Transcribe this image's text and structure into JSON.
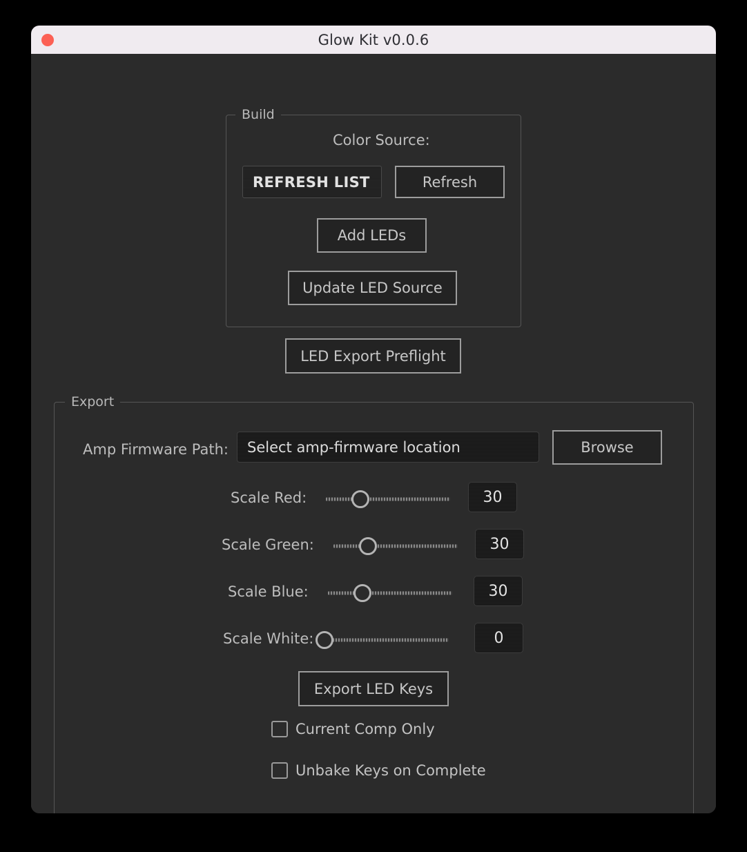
{
  "window": {
    "title": "Glow Kit v0.0.6",
    "close_button": "close",
    "background_color": "#2b2b2b",
    "titlebar_color": "#f0ebf0",
    "accent_close_color": "#fc6054"
  },
  "build": {
    "legend": "Build",
    "color_source_label": "Color Source:",
    "color_source_dropdown": {
      "value": "REFRESH LIST",
      "options": [
        "REFRESH LIST"
      ]
    },
    "refresh_button": "Refresh",
    "add_leds_button": "Add LEDs",
    "update_led_source_button": "Update LED Source"
  },
  "preflight": {
    "led_export_preflight_button": "LED Export Preflight"
  },
  "export": {
    "legend": "Export",
    "amp_firmware_path_label": "Amp Firmware Path:",
    "amp_firmware_path_value": "Select amp-firmware location",
    "amp_firmware_path_placeholder": "Select amp-firmware location",
    "browse_button": "Browse",
    "sliders": [
      {
        "label": "Scale Red:",
        "value": "30",
        "percent": 28
      },
      {
        "label": "Scale Green:",
        "value": "30",
        "percent": 28
      },
      {
        "label": "Scale Blue:",
        "value": "30",
        "percent": 28
      },
      {
        "label": "Scale White:",
        "value": "0",
        "percent": 0
      }
    ],
    "export_led_keys_button": "Export LED Keys",
    "checkboxes": [
      {
        "label": "Current Comp Only",
        "checked": false
      },
      {
        "label": "Unbake Keys on Complete",
        "checked": false
      }
    ]
  }
}
